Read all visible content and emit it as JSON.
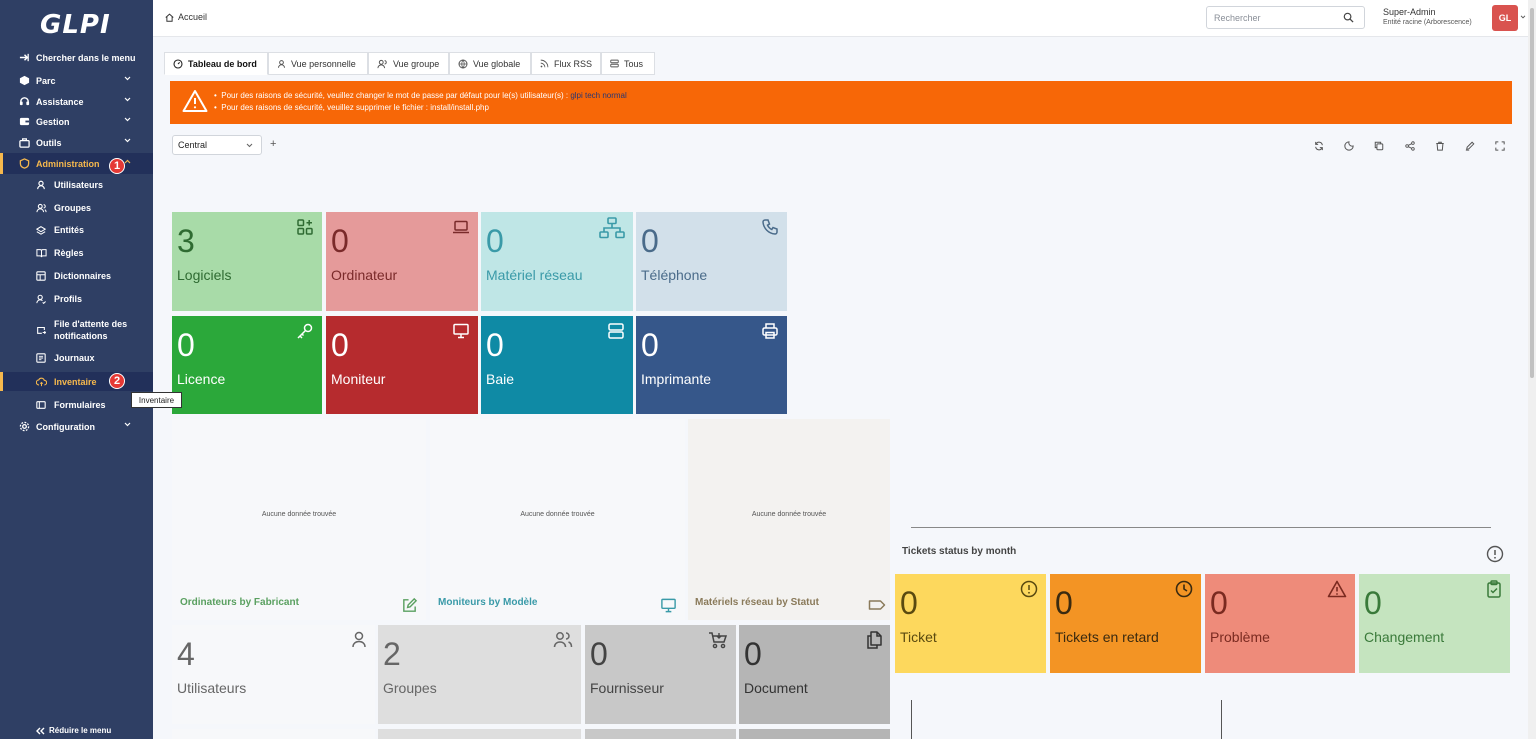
{
  "app": {
    "logo": "GLPI"
  },
  "sidebar": {
    "items": [
      {
        "label": "Chercher dans le menu",
        "icon": "arrow-right-icon"
      },
      {
        "label": "Parc",
        "icon": "box-icon"
      },
      {
        "label": "Assistance",
        "icon": "headset-icon"
      },
      {
        "label": "Gestion",
        "icon": "wallet-icon"
      },
      {
        "label": "Outils",
        "icon": "briefcase-icon"
      },
      {
        "label": "Administration",
        "icon": "shield-icon"
      },
      {
        "label": "Configuration",
        "icon": "gear-icon"
      }
    ],
    "admin_sub": [
      {
        "label": "Utilisateurs",
        "icon": "user-icon"
      },
      {
        "label": "Groupes",
        "icon": "users-icon"
      },
      {
        "label": "Entités",
        "icon": "layers-icon"
      },
      {
        "label": "Règles",
        "icon": "book-icon"
      },
      {
        "label": "Dictionnaires",
        "icon": "table-icon"
      },
      {
        "label": "Profils",
        "icon": "user-check-icon"
      },
      {
        "label": "File d'attente des notifications",
        "icon": "mail-forward-icon"
      },
      {
        "label": "Journaux",
        "icon": "news-icon"
      },
      {
        "label": "Inventaire",
        "icon": "cloud-upload-icon"
      },
      {
        "label": "Formulaires",
        "icon": "forms-icon"
      }
    ],
    "badge_1": "1",
    "badge_2": "2",
    "tooltip": "Inventaire",
    "collapse_label": "Réduire le menu"
  },
  "topbar": {
    "breadcrumb": "Accueil",
    "search_placeholder": "Rechercher",
    "user_name": "Super-Admin",
    "user_entity": "Entité racine (Arborescence)",
    "avatar": "GL"
  },
  "tabs": [
    {
      "label": "Tableau de bord",
      "icon": "dashboard-icon"
    },
    {
      "label": "Vue personnelle",
      "icon": "user-icon"
    },
    {
      "label": "Vue groupe",
      "icon": "users-icon"
    },
    {
      "label": "Vue globale",
      "icon": "globe-icon"
    },
    {
      "label": "Flux RSS",
      "icon": "rss-icon"
    },
    {
      "label": "Tous",
      "icon": "list-icon"
    }
  ],
  "alert": {
    "line1_prefix": "Pour des raisons de sécurité, veuillez changer le mot de passe par défaut pour le(s) utilisateur(s) : ",
    "line1_users": "glpi tech normal",
    "line2": "Pour des raisons de sécurité, veuillez supprimer le fichier : install/install.php"
  },
  "dashboard": {
    "selected": "Central",
    "add": "+",
    "tools": [
      "refresh-icon",
      "moon-icon",
      "copy-icon",
      "share-icon",
      "trash-icon",
      "edit-icon",
      "fullscreen-icon"
    ]
  },
  "cards": [
    {
      "num": "3",
      "label": "Logiciels",
      "icon": "apps-icon",
      "bg": "#a8dba8",
      "fg": "#2f6b32"
    },
    {
      "num": "0",
      "label": "Ordinateur",
      "icon": "laptop-icon",
      "bg": "#e59a9a",
      "fg": "#7a2a2a"
    },
    {
      "num": "0",
      "label": "Matériel réseau",
      "icon": "network-icon",
      "bg": "#bfe6e6",
      "fg": "#3a9aa8"
    },
    {
      "num": "0",
      "label": "Téléphone",
      "icon": "phone-icon",
      "bg": "#d2e0ea",
      "fg": "#4a6b8a"
    },
    {
      "num": "0",
      "label": "Licence",
      "icon": "key-icon",
      "bg": "#2ba83a",
      "fg": "#ffffff"
    },
    {
      "num": "0",
      "label": "Moniteur",
      "icon": "monitor-icon",
      "bg": "#b62b2e",
      "fg": "#ffffff"
    },
    {
      "num": "0",
      "label": "Baie",
      "icon": "server-icon",
      "bg": "#0f8aa5",
      "fg": "#ffffff"
    },
    {
      "num": "0",
      "label": "Imprimante",
      "icon": "printer-icon",
      "bg": "#36578a",
      "fg": "#ffffff"
    }
  ],
  "chart_cards": [
    {
      "title": "Ordinateurs by Fabricant",
      "empty": "Aucune donnée trouvée",
      "icon": "edit-square-icon",
      "color": "#5aa060"
    },
    {
      "title": "Moniteurs by Modèle",
      "empty": "Aucune donnée trouvée",
      "icon": "monitor-icon",
      "color": "#3a9aa8"
    },
    {
      "title": "Matériels réseau by Statut",
      "empty": "Aucune donnée trouvée",
      "icon": "tag-icon",
      "color": "#8a7a5a"
    }
  ],
  "cards2": [
    {
      "num": "4",
      "label": "Utilisateurs",
      "icon": "user-icon",
      "bg": "#f7f8fa",
      "fg": "#666666"
    },
    {
      "num": "2",
      "label": "Groupes",
      "icon": "users-icon",
      "bg": "#dedede",
      "fg": "#666666"
    },
    {
      "num": "0",
      "label": "Fournisseur",
      "icon": "cart-icon",
      "bg": "#c8c8c8",
      "fg": "#444444"
    },
    {
      "num": "0",
      "label": "Document",
      "icon": "files-icon",
      "bg": "#b5b5b5",
      "fg": "#333333"
    }
  ],
  "tickets": {
    "title": "Tickets status by month",
    "cards": [
      {
        "num": "0",
        "label": "Ticket",
        "icon": "alert-circle-icon",
        "bg": "#fdd85d",
        "fg": "#5a4a10"
      },
      {
        "num": "0",
        "label": "Tickets en retard",
        "icon": "clock-icon",
        "bg": "#f39424",
        "fg": "#3a2a10"
      },
      {
        "num": "0",
        "label": "Problème",
        "icon": "alert-triangle-icon",
        "bg": "#ee8b7a",
        "fg": "#7a2a20"
      },
      {
        "num": "0",
        "label": "Changement",
        "icon": "clipboard-check-icon",
        "bg": "#c5e4bf",
        "fg": "#3a7a3a"
      }
    ]
  }
}
